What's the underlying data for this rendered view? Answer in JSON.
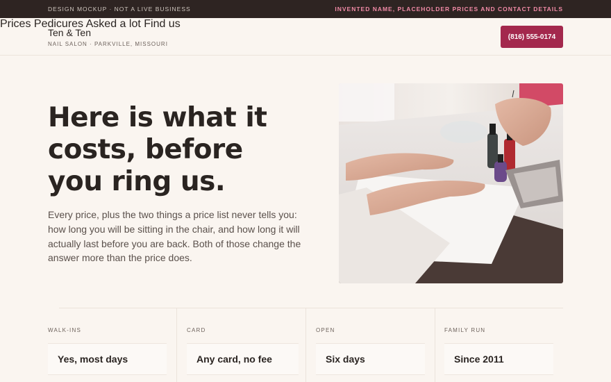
{
  "topbar": {
    "left_text": "DESIGN MOCKUP · NOT A LIVE BUSINESS",
    "right_text": "INVENTED NAME, PLACEHOLDER PRICES AND CONTACT DETAILS"
  },
  "header": {
    "brand_name": "Ten & Ten",
    "brand_tagline": "NAIL SALON · PARKVILLE, MISSOURI",
    "nav": [
      "Prices",
      "Pedicures",
      "Asked a lot",
      "Find us"
    ],
    "phone_button": "(816) 555-0174"
  },
  "hero": {
    "title": "Here is what it costs, before you ring us.",
    "body": "Every price, plus the two things a price list never tells you: how long you will be sitting in the chair, and how long it will actually last before you are back. Both of those change the answer more than the price does."
  },
  "facts": [
    {
      "label": "WALK-INS",
      "value": "Yes, most days"
    },
    {
      "label": "CARD",
      "value": "Any card, no fee"
    },
    {
      "label": "OPEN",
      "value": "Six days"
    },
    {
      "label": "FAMILY RUN",
      "value": "Since 2011"
    }
  ],
  "colors": {
    "accent": "#a3284d",
    "topbar_bg": "#2e2422",
    "page_bg": "#faf5f0",
    "notice_pink": "#f08aa6"
  }
}
